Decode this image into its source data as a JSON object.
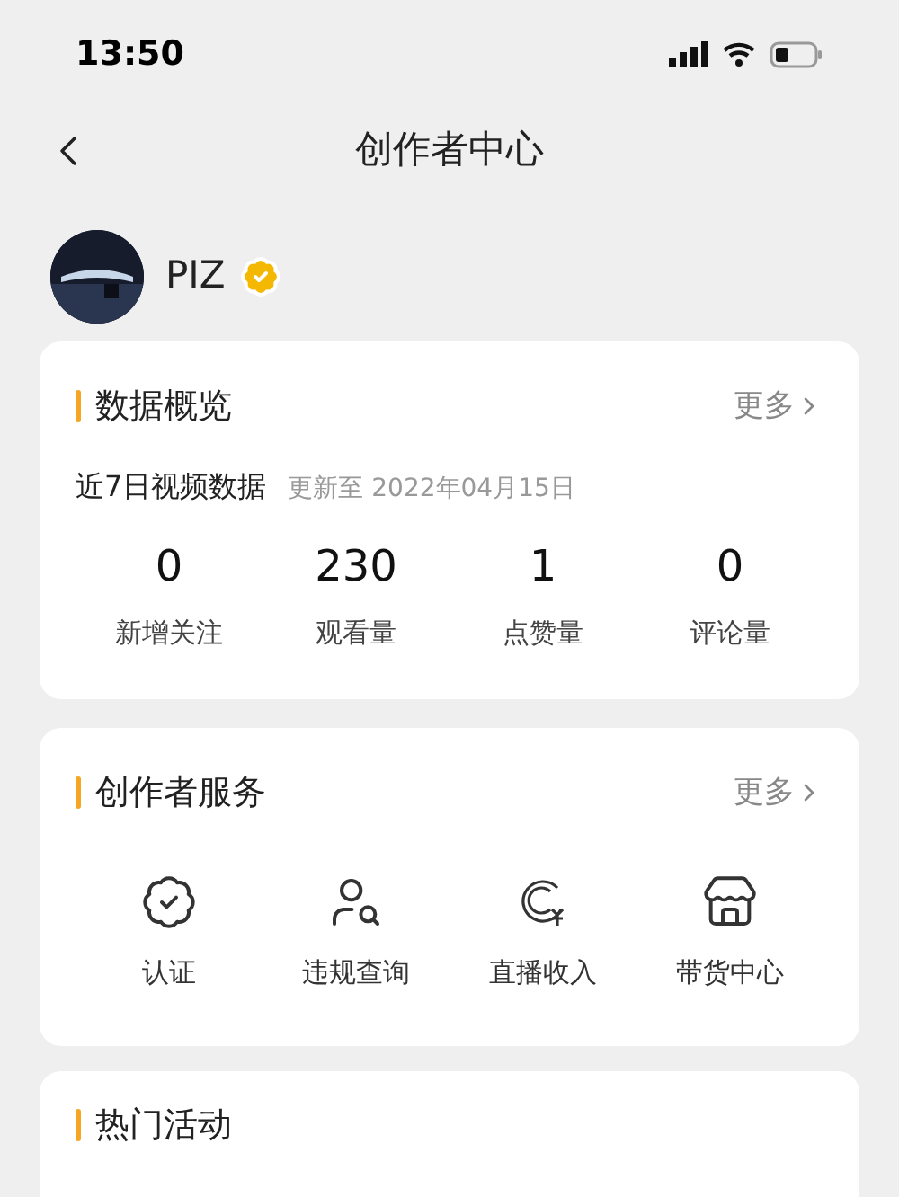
{
  "status_bar": {
    "time": "13:50"
  },
  "header": {
    "title": "创作者中心"
  },
  "profile": {
    "name": "PIZ",
    "verified": true
  },
  "overview": {
    "title": "数据概览",
    "more": "更多",
    "subtitle": "近7日视频数据",
    "updated": "更新至 2022年04月15日",
    "stats": [
      {
        "value": "0",
        "label": "新增关注"
      },
      {
        "value": "230",
        "label": "观看量"
      },
      {
        "value": "1",
        "label": "点赞量"
      },
      {
        "value": "0",
        "label": "评论量"
      }
    ]
  },
  "services": {
    "title": "创作者服务",
    "more": "更多",
    "items": [
      {
        "kind": "badge",
        "label": "认证"
      },
      {
        "kind": "person-search",
        "label": "违规查询"
      },
      {
        "kind": "income",
        "label": "直播收入"
      },
      {
        "kind": "store",
        "label": "带货中心"
      }
    ]
  },
  "activities": {
    "title": "热门活动"
  }
}
